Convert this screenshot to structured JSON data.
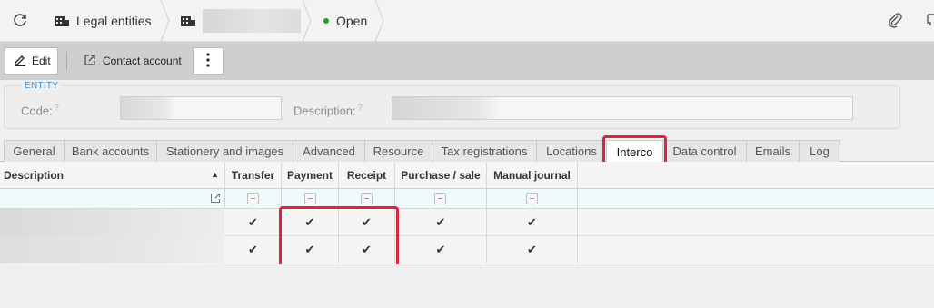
{
  "breadcrumb": {
    "legal_entities": "Legal entities",
    "status": "Open",
    "status_color": "#1a9f29"
  },
  "toolbar": {
    "edit_label": "Edit",
    "contact_account_label": "Contact account"
  },
  "entity": {
    "group_title": "ENTITY",
    "code_label": "Code:",
    "description_label": "Description:",
    "help_mark": "?"
  },
  "tabs": [
    {
      "label": "General"
    },
    {
      "label": "Bank accounts"
    },
    {
      "label": "Stationery and images"
    },
    {
      "label": "Advanced"
    },
    {
      "label": "Resource"
    },
    {
      "label": "Tax registrations"
    },
    {
      "label": "Locations"
    },
    {
      "label": "Interco",
      "active": true
    },
    {
      "label": "Data control"
    },
    {
      "label": "Emails"
    },
    {
      "label": "Log"
    }
  ],
  "grid": {
    "columns": [
      "Description",
      "Transfer",
      "Payment",
      "Receipt",
      "Purchase / sale",
      "Manual journal"
    ],
    "sort_indicator": "▲",
    "rows": [
      {
        "transfer": "✔",
        "payment": "✔",
        "receipt": "✔",
        "purchase_sale": "✔",
        "manual_journal": "✔"
      },
      {
        "transfer": "✔",
        "payment": "✔",
        "receipt": "✔",
        "purchase_sale": "✔",
        "manual_journal": "✔"
      }
    ]
  },
  "colors": {
    "highlight": "#d7263d",
    "accent": "#3b8ccf"
  }
}
